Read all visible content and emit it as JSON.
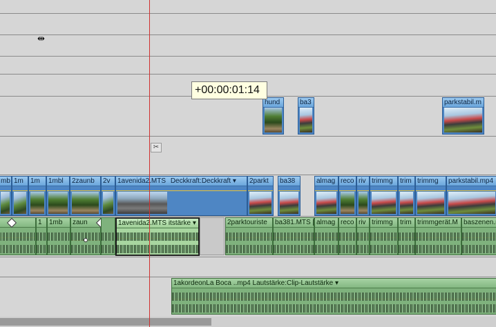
{
  "timecode": "+00:00:01:14",
  "video_track_upper": {
    "clips": [
      {
        "label": "hund"
      },
      {
        "label": "ba3"
      },
      {
        "label": "parkstabil.m"
      }
    ]
  },
  "video_track_main": {
    "clips": [
      {
        "label": "mb"
      },
      {
        "label": "1m"
      },
      {
        "label": "1m"
      },
      {
        "label": "1mbl"
      },
      {
        "label": "2zaunb"
      },
      {
        "label": "2v"
      },
      {
        "label": "1avenida2.MTS"
      },
      {
        "label": "Deckkraft:Deckkraft ▾"
      },
      {
        "label": "2parkt"
      },
      {
        "label": "ba38"
      },
      {
        "label": "almag"
      },
      {
        "label": "reco"
      },
      {
        "label": "riv"
      },
      {
        "label": "trimmg"
      },
      {
        "label": "trim"
      },
      {
        "label": "trimmg"
      },
      {
        "label": "parkstabil.mp4"
      }
    ]
  },
  "audio_track_main": {
    "clips": [
      {
        "label": ""
      },
      {
        "label": "1"
      },
      {
        "label": "1mb"
      },
      {
        "label": "zaun"
      },
      {
        "label": "1avenida2.MTS  itstärke ▾"
      },
      {
        "label": "2parktouriste"
      },
      {
        "label": "ba381.MTS ["
      },
      {
        "label": "almag"
      },
      {
        "label": "reco"
      },
      {
        "label": "riv"
      },
      {
        "label": "trimmg"
      },
      {
        "label": "trim"
      },
      {
        "label": "trimmgerät.M"
      },
      {
        "label": "baszenen.m"
      }
    ]
  },
  "audio_track_lower": {
    "clips": [
      {
        "label": "1akordeonLa Boca ..mp4  Lautstärke:Clip-Lautstärke ▾"
      }
    ]
  }
}
